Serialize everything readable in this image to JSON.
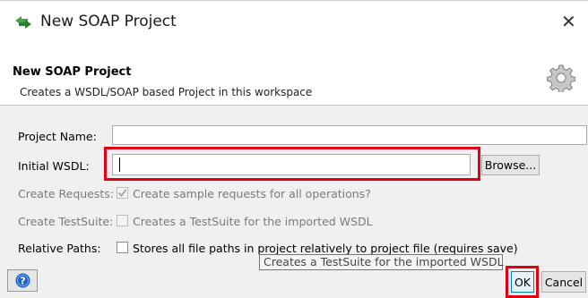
{
  "window": {
    "title": "New SOAP Project",
    "close_glyph": "✕",
    "app_icon": "soapui-arrows-icon"
  },
  "header": {
    "title": "New SOAP Project",
    "description": "Creates a WSDL/SOAP based Project in this workspace",
    "icon": "gear-icon"
  },
  "form": {
    "project_name_label": "Project Name:",
    "project_name_value": "",
    "initial_wsdl_label": "Initial WSDL:",
    "initial_wsdl_value": "",
    "browse_label": "Browse...",
    "create_requests_label": "Create Requests:",
    "create_requests_text": "Create sample requests for all operations?",
    "create_requests_checked": true,
    "create_requests_enabled": false,
    "create_testsuite_label": "Create TestSuite:",
    "create_testsuite_text": "Creates a TestSuite for the imported WSDL",
    "create_testsuite_checked": false,
    "create_testsuite_enabled": false,
    "relative_paths_label": "Relative Paths:",
    "relative_paths_text": "Stores all file paths in project relatively to project file (requires save)",
    "relative_paths_checked": false
  },
  "tooltip": {
    "text": "Creates a TestSuite for the imported WSDL"
  },
  "footer": {
    "help_icon": "help-icon",
    "ok_label": "OK",
    "cancel_label": "Cancel"
  },
  "colors": {
    "highlight": "#e00012",
    "accent_green": "#49a34b",
    "help_blue": "#1f63c6"
  }
}
